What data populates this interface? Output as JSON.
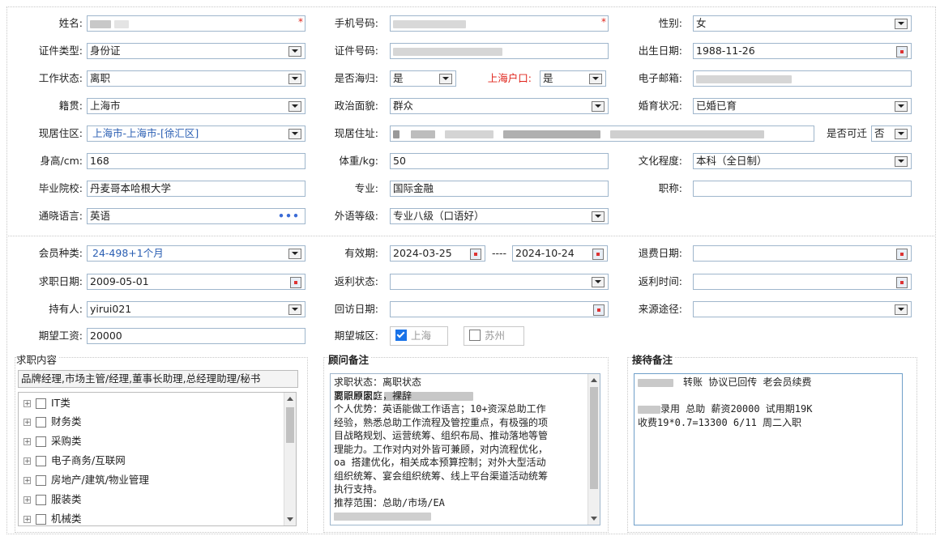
{
  "row1": {
    "name_label": "姓名:",
    "phone_label": "手机号码:",
    "gender_label": "性别:",
    "gender_value": "女"
  },
  "row2": {
    "idtype_label": "证件类型:",
    "idtype_value": "身份证",
    "idno_label": "证件号码:",
    "birth_label": "出生日期:",
    "birth_value": "1988-11-26"
  },
  "row3": {
    "work_label": "工作状态:",
    "work_value": "离职",
    "overseas_label": "是否海归:",
    "overseas_value": "是",
    "hukou_label": "上海户口:",
    "hukou_value": "是",
    "email_label": "电子邮箱:"
  },
  "row4": {
    "native_label": "籍贯:",
    "native_value": "上海市",
    "political_label": "政治面貌:",
    "political_value": "群众",
    "marital_label": "婚育状况:",
    "marital_value": "已婚已育"
  },
  "row5": {
    "region_label": "现居住区:",
    "region_value": "上海市-上海市-[徐汇区]",
    "address_label": "现居住址:",
    "relocate_label": "是否可迁",
    "relocate_value": "否"
  },
  "row6": {
    "height_label": "身高/cm:",
    "height_value": "168",
    "weight_label": "体重/kg:",
    "weight_value": "50",
    "edu_label": "文化程度:",
    "edu_value": "本科（全日制）"
  },
  "row7": {
    "school_label": "毕业院校:",
    "school_value": "丹麦哥本哈根大学",
    "major_label": "专业:",
    "major_value": "国际金融",
    "title_label": "职称:"
  },
  "row8": {
    "lang_label": "通晓语言:",
    "lang_value": "英语",
    "lang_level_label": "外语等级:",
    "lang_level_value": "专业八级（口语好）"
  },
  "row9": {
    "member_label": "会员种类:",
    "member_value": "24-498+1个月",
    "valid_label": "有效期:",
    "valid_from": "2024-03-25",
    "valid_sep": "----",
    "valid_to": "2024-10-24",
    "refund_label": "退费日期:"
  },
  "row10": {
    "apply_label": "求职日期:",
    "apply_value": "2009-05-01",
    "rebate_label": "返利状态:",
    "rebate_time_label": "返利时间:"
  },
  "row11": {
    "holder_label": "持有人:",
    "holder_value": "yirui021",
    "revisit_label": "回访日期:",
    "source_label": "来源途径:"
  },
  "row12": {
    "salary_label": "期望工资:",
    "salary_value": "20000",
    "city_label": "期望城区:",
    "city_options": [
      {
        "label": "上海",
        "checked": true
      },
      {
        "label": "苏州",
        "checked": false
      }
    ]
  },
  "job": {
    "legend": "求职内容",
    "selected": "品牌经理,市场主管/经理,董事长助理,总经理助理/秘书",
    "categories": [
      "IT类",
      "财务类",
      "采购类",
      "电子商务/互联网",
      "房地产/建筑/物业管理",
      "服装类",
      "机械类"
    ]
  },
  "advisor": {
    "legend": "顾问备注",
    "lines": [
      "求职状态：离职状态",
      "离职原因：",
      "        要照顾家庭，裸辞",
      "个人优势：英语能做工作语言；10+资深总助工作",
      "经验，熟悉总助工作流程及管控重点，有极强的项",
      "目战略规划、运营统筹、组织布局、推动落地等管",
      "理能力。工作对内对外皆可兼顾，对内流程优化，",
      "oa 搭建优化，相关成本预算控制；对外大型活动",
      "组织统筹、宴会组织统筹、线上平台渠道活动统筹",
      "执行支持。",
      "推荐范围：总助/市场/EA"
    ]
  },
  "reception": {
    "legend": "接待备注",
    "line1": "转账 协议已回传  老会员续费",
    "line2": "录用 总助 薪资20000 试用期19K",
    "line3": "收费19*0.7=13300  6/11 周二入职"
  },
  "colors": {
    "required": "#e0241b",
    "border": "#9fb6cc",
    "accent": "#1a73e8"
  }
}
